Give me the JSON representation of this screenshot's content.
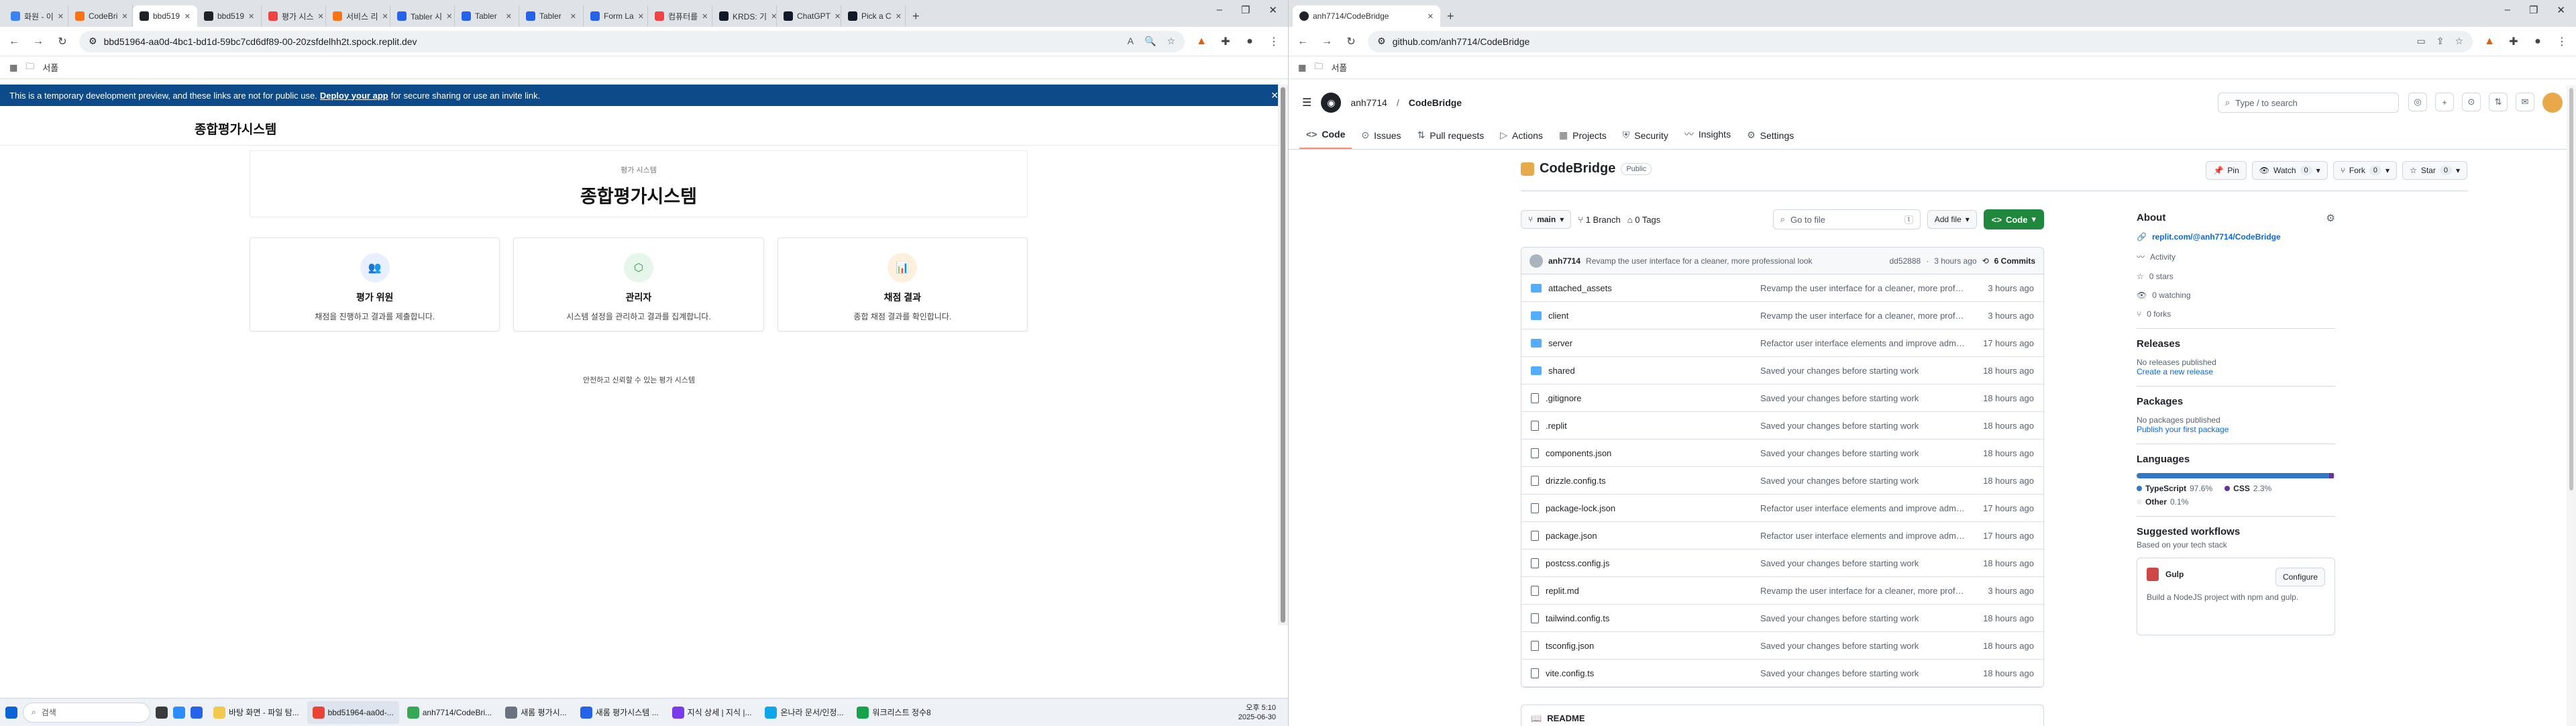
{
  "left": {
    "tabs": [
      {
        "label": "화원 - 이",
        "color": "#3b82f6"
      },
      {
        "label": "CodeBri",
        "color": "#f97316"
      },
      {
        "label": "bbd519",
        "color": "#1f2328",
        "active": true
      },
      {
        "label": "bbd519",
        "color": "#1f2328"
      },
      {
        "label": "평가 시스",
        "color": "#ef4444"
      },
      {
        "label": "서비스 리",
        "color": "#f97316"
      },
      {
        "label": "Tabler 시",
        "color": "#2563eb"
      },
      {
        "label": "Tabler",
        "color": "#2563eb"
      },
      {
        "label": "Tabler",
        "color": "#2563eb"
      },
      {
        "label": "Form La",
        "color": "#2563eb"
      },
      {
        "label": "컴퓨터를",
        "color": "#ef4444"
      },
      {
        "label": "KRDS: 기",
        "color": "#111827"
      },
      {
        "label": "ChatGPT",
        "color": "#111827"
      },
      {
        "label": "Pick a C",
        "color": "#111827"
      }
    ],
    "url": "bbd51964-aa0d-4bc1-bd1d-59bc7cd6df89-00-20zsfdelhh2t.spock.replit.dev",
    "bookmark": "서폴",
    "banner": {
      "text": "This is a temporary development preview, and these links are not for public use.",
      "link": "Deploy your app",
      "text2": "for secure sharing or use an invite link."
    },
    "app_title": "종합평가시스템",
    "header_small": "평가 시스템",
    "header_big": "종합평가시스템",
    "cards": [
      {
        "title": "평가 위원",
        "desc": "채점을 진행하고 결과를 제출합니다.",
        "icon": "users-icon",
        "bg": "#e8efff",
        "fg": "#3b5bdb",
        "glyph": "👥"
      },
      {
        "title": "관리자",
        "desc": "시스템 설정을 관리하고 결과를 집계합니다.",
        "icon": "shield-icon",
        "bg": "#e6f6ea",
        "fg": "#2f9e44",
        "glyph": "⬡"
      },
      {
        "title": "채점 결과",
        "desc": "종합 채점 결과를 확인합니다.",
        "icon": "chart-icon",
        "bg": "#fdf1dd",
        "fg": "#e08a00",
        "glyph": "📊"
      }
    ],
    "footer": "안전하고 신뢰할 수 있는 평가 시스템"
  },
  "taskbar": {
    "search": "검색",
    "items": [
      {
        "label": "바탕 화면 - 파일 탐...",
        "color": "#f2c94c"
      },
      {
        "label": "bbd51964-aa0d-...",
        "color": "#ea4335",
        "active": true
      },
      {
        "label": "anh7714/CodeBri...",
        "color": "#34a853"
      },
      {
        "label": "새롬 평가시...",
        "color": "#6b7280"
      },
      {
        "label": "새롬 평가시스템 ...",
        "color": "#2563eb"
      },
      {
        "label": "지식 상세 | 지식 |...",
        "color": "#7c3aed"
      },
      {
        "label": "온나라 문서/인정...",
        "color": "#0ea5e9"
      },
      {
        "label": "워크리스트 정수8",
        "color": "#16a34a"
      }
    ],
    "time": "오후 5:10",
    "date": "2025-06-30"
  },
  "right": {
    "tab": "anh7714/CodeBridge",
    "url": "github.com/anh7714/CodeBridge",
    "bookmark": "서폴",
    "breadcrumb_owner": "anh7714",
    "breadcrumb_repo": "CodeBridge",
    "search_placeholder": "Type / to search",
    "nav": [
      "Code",
      "Issues",
      "Pull requests",
      "Actions",
      "Projects",
      "Security",
      "Insights",
      "Settings"
    ],
    "repo": {
      "name": "CodeBridge",
      "visibility": "Public"
    },
    "buttons": {
      "pin": "Pin",
      "watch": "Watch",
      "watch_count": "0",
      "fork": "Fork",
      "fork_count": "0",
      "star": "Star",
      "star_count": "0"
    },
    "branch": "main",
    "branches": "1 Branch",
    "tags": "0 Tags",
    "goto": "Go to file",
    "goto_key": "t",
    "addfile": "Add file",
    "code": "Code",
    "commit": {
      "author": "anh7714",
      "message": "Revamp the user interface for a cleaner, more professional look",
      "hash": "dd52888",
      "time": "3 hours ago",
      "commits": "6 Commits"
    },
    "files": [
      {
        "name": "attached_assets",
        "type": "dir",
        "msg": "Revamp the user interface for a cleaner, more professional l...",
        "time": "3 hours ago"
      },
      {
        "name": "client",
        "type": "dir",
        "msg": "Revamp the user interface for a cleaner, more professional l...",
        "time": "3 hours ago"
      },
      {
        "name": "server",
        "type": "dir",
        "msg": "Refactor user interface elements and improve admin functio...",
        "time": "17 hours ago"
      },
      {
        "name": "shared",
        "type": "dir",
        "msg": "Saved your changes before starting work",
        "time": "18 hours ago"
      },
      {
        "name": ".gitignore",
        "type": "file",
        "msg": "Saved your changes before starting work",
        "time": "18 hours ago"
      },
      {
        "name": ".replit",
        "type": "file",
        "msg": "Saved your changes before starting work",
        "time": "18 hours ago"
      },
      {
        "name": "components.json",
        "type": "file",
        "msg": "Saved your changes before starting work",
        "time": "18 hours ago"
      },
      {
        "name": "drizzle.config.ts",
        "type": "file",
        "msg": "Saved your changes before starting work",
        "time": "18 hours ago"
      },
      {
        "name": "package-lock.json",
        "type": "file",
        "msg": "Refactor user interface elements and improve admin functio...",
        "time": "17 hours ago"
      },
      {
        "name": "package.json",
        "type": "file",
        "msg": "Refactor user interface elements and improve admin functio...",
        "time": "17 hours ago"
      },
      {
        "name": "postcss.config.js",
        "type": "file",
        "msg": "Saved your changes before starting work",
        "time": "18 hours ago"
      },
      {
        "name": "replit.md",
        "type": "file",
        "msg": "Revamp the user interface for a cleaner, more professional l...",
        "time": "3 hours ago"
      },
      {
        "name": "tailwind.config.ts",
        "type": "file",
        "msg": "Saved your changes before starting work",
        "time": "18 hours ago"
      },
      {
        "name": "tsconfig.json",
        "type": "file",
        "msg": "Saved your changes before starting work",
        "time": "18 hours ago"
      },
      {
        "name": "vite.config.ts",
        "type": "file",
        "msg": "Saved your changes before starting work",
        "time": "18 hours ago"
      }
    ],
    "readme": "README",
    "about": {
      "title": "About",
      "link": "replit.com/@anh7714/CodeBridge",
      "items": [
        {
          "icon": "pulse-icon",
          "label": "Activity"
        },
        {
          "icon": "star-icon",
          "label": "0 stars"
        },
        {
          "icon": "eye-icon",
          "label": "0 watching"
        },
        {
          "icon": "fork-icon",
          "label": "0 forks"
        }
      ]
    },
    "releases": {
      "title": "Releases",
      "none": "No releases published",
      "link": "Create a new release"
    },
    "packages": {
      "title": "Packages",
      "none": "No packages published",
      "link": "Publish your first package"
    },
    "languages": {
      "title": "Languages",
      "items": [
        {
          "name": "TypeScript",
          "pct": "97.6%",
          "value": 97.6,
          "color": "#3178c6"
        },
        {
          "name": "CSS",
          "pct": "2.3%",
          "value": 2.3,
          "color": "#663399"
        },
        {
          "name": "Other",
          "pct": "0.1%",
          "value": 0.1,
          "color": "#ededed"
        }
      ]
    },
    "workflows": {
      "title": "Suggested workflows",
      "sub": "Based on your tech stack",
      "name": "Gulp",
      "configure": "Configure",
      "desc": "Build a NodeJS project with npm and gulp."
    }
  }
}
